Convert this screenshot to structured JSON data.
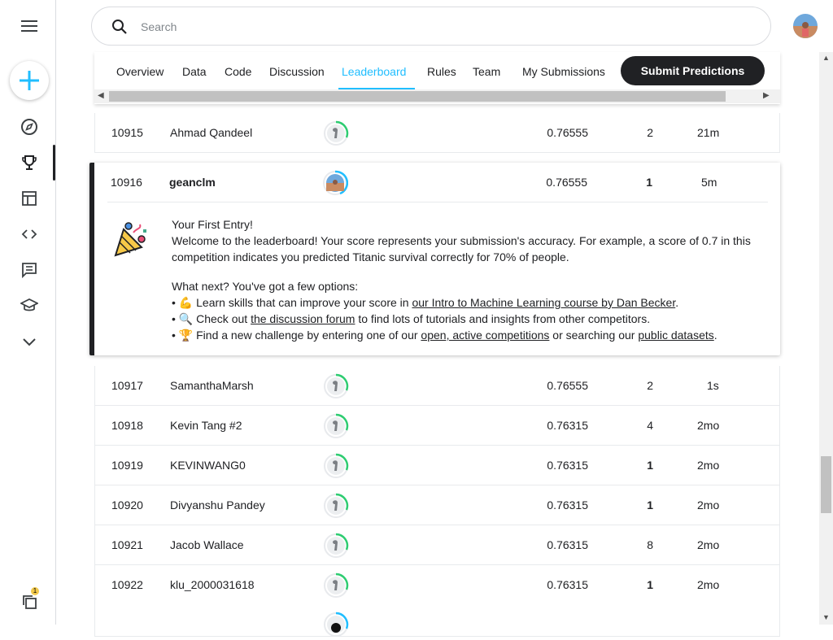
{
  "search": {
    "placeholder": "Search"
  },
  "tabs": [
    {
      "label": "Overview"
    },
    {
      "label": "Data"
    },
    {
      "label": "Code"
    },
    {
      "label": "Discussion"
    },
    {
      "label": "Leaderboard",
      "active": true
    },
    {
      "label": "Rules"
    },
    {
      "label": "Team"
    },
    {
      "label": "My Submissions"
    }
  ],
  "submit_label": "Submit Predictions",
  "notification_count": "1",
  "rows_above": [
    {
      "rank": "10915",
      "name": "Ahmad Qandeel",
      "score": "0.76555",
      "entries": "2",
      "last": "21m"
    }
  ],
  "my_row": {
    "rank": "10916",
    "name": "geanclm",
    "score": "0.76555",
    "entries": "1",
    "last": "5m"
  },
  "message": {
    "title": "Your First Entry!",
    "body": "Welcome to the leaderboard! Your score represents your submission's accuracy. For example, a score of 0.7 in this competition indicates you predicted Titanic survival correctly for 70% of people.",
    "next": "What next? You've got a few options:",
    "item1_pre": "Learn skills that can improve your score in ",
    "item1_link": "our Intro to Machine Learning course by Dan Becker",
    "item1_post": ".",
    "item2_pre": "Check out ",
    "item2_link": "the discussion forum",
    "item2_post": " to find lots of tutorials and insights from other competitors.",
    "item3_pre": "Find a new challenge by entering one of our ",
    "item3_link": "open, active competitions",
    "item3_mid": " or searching our ",
    "item3_link2": "public datasets",
    "item3_post": "."
  },
  "rows_below": [
    {
      "rank": "10917",
      "name": "SamanthaMarsh",
      "score": "0.76555",
      "entries": "2",
      "last": "1s"
    },
    {
      "rank": "10918",
      "name": "Kevin Tang #2",
      "score": "0.76315",
      "entries": "4",
      "last": "2mo"
    },
    {
      "rank": "10919",
      "name": "KEVINWANG0",
      "score": "0.76315",
      "entries": "1",
      "last": "2mo"
    },
    {
      "rank": "10920",
      "name": "Divyanshu Pandey",
      "score": "0.76315",
      "entries": "1",
      "last": "2mo"
    },
    {
      "rank": "10921",
      "name": "Jacob Wallace",
      "score": "0.76315",
      "entries": "8",
      "last": "2mo"
    },
    {
      "rank": "10922",
      "name": "klu_2000031618",
      "score": "0.76315",
      "entries": "1",
      "last": "2mo"
    }
  ]
}
